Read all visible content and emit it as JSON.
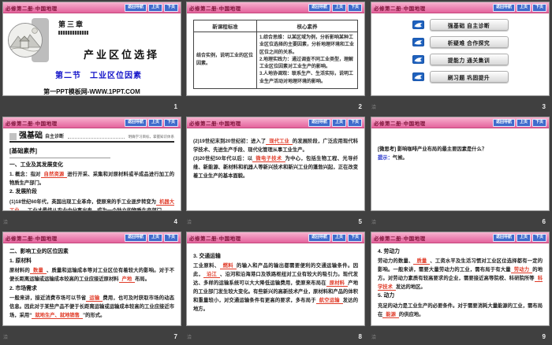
{
  "chrome": {
    "header_title": "必修第二册·中国地理",
    "nav_back": "返回导航",
    "nav_prev": "上页",
    "nav_next": "下页",
    "watermark": "洽",
    "accent_pink": "#ef8db8",
    "button_blue": "#3f6bcc",
    "blank_red": "#e03b28"
  },
  "s1": {
    "page": "1",
    "chapter": "第三章",
    "title": "产业区位选择",
    "subtitle": "第二节　工业区位因素",
    "footer": "第一PPT模板网-WWW.1PPT.COM"
  },
  "s2": {
    "page": "2",
    "col1": "新课程标准",
    "col2": "核心素养",
    "cell1": "结合实例，说明工业的区位因素。",
    "items": [
      "1.综合思维：以某区域为例，分析影响某种工业区位选择的主要因素，分析地理环境和工业区位之间的关系。",
      "2.地理实践力：通过调查不同工业类型，理解工业区位因素对工业生产的影响。",
      "3.人地协调观：联系生产、生活实际，说明工业生产活动对地理环境的影响。"
    ]
  },
  "s3": {
    "page": "3",
    "menu": [
      {
        "label": "强基础 自主诊断"
      },
      {
        "label": "析疑难 合作探究"
      },
      {
        "label": "提能力 通关集训"
      },
      {
        "label": "刷习题 巩固提升"
      }
    ]
  },
  "s4": {
    "page": "4",
    "section_big": "强基础",
    "section_small": "自主诊断",
    "section_note": "明确学习目标，掌握知识体系",
    "tag": "[基础素养]",
    "h1": "一、工业及其发展变化",
    "p1": [
      {
        "t": "1. 概念：指对"
      },
      {
        "b": "自然资源"
      },
      {
        "t": "进行开采、采集和对原材料或半成品进行加工的物质生产部门。"
      }
    ],
    "h2": "2. 发展阶段",
    "p2": [
      {
        "t": "(1)18世纪60年代，英国出现工业革命，使原来的手工业逐步转变为"
      },
      {
        "b": "机器大工业"
      },
      {
        "t": "，工业才最终从农业中分离出来，成为一个独立的物质生产部门。"
      }
    ]
  },
  "s5": {
    "page": "5",
    "p1": [
      {
        "t": "(2)19世纪末到20世纪初：进入了"
      },
      {
        "b": "现代工业"
      },
      {
        "t": "的发展阶段，广泛应用现代科学技术、先进生产手段、现代化管理从事工业生产。"
      }
    ],
    "p2": [
      {
        "t": "(3)20世纪50年代以后：以"
      },
      {
        "b": "微电子技术"
      },
      {
        "t": "为中心，包括生物工程、光导纤维、新能源、新材料和机器人等新兴技术和新兴工业的蓬勃兴起，正在改变着工业生产的基本面貌。"
      }
    ]
  },
  "s6": {
    "page": "6",
    "q": [
      {
        "k": "[微思考]"
      },
      {
        "t": " 影响咖啡产业布局的最主要因素是什么？"
      }
    ],
    "a": [
      {
        "c": "提示："
      },
      {
        "t": "气候。"
      }
    ]
  },
  "s7": {
    "page": "7",
    "h1": "二、影响工业的区位因素",
    "h2": "1. 原材料",
    "p1": [
      {
        "t": "原材料的"
      },
      {
        "b": "数量"
      },
      {
        "t": "、质量和运输成本等对工业区位有着较大的影响。对于不便长距离运输或运输成本较高的工业应接近原材料"
      },
      {
        "b": "产地"
      },
      {
        "t": "布局。"
      }
    ],
    "h3": "2. 市场需求",
    "p2": [
      {
        "t": "一般来讲，接近消费市场可以节省"
      },
      {
        "b": "运输"
      },
      {
        "t": "费用，也可及时获取市场的动态信息。因此对于某些产品不便于长距离运输或运输成本较高的工业应接近市场，采用“"
      },
      {
        "b": "就地生产、就地销售"
      },
      {
        "t": "”的形式。"
      }
    ]
  },
  "s8": {
    "page": "8",
    "h1": "3. 交通运输",
    "p1": [
      {
        "t": "工业原料、"
      },
      {
        "b": "燃料"
      },
      {
        "t": "的输入和产品的输出都需要便利的交通运输条件。因此，"
      },
      {
        "b": "沿江"
      },
      {
        "t": "、沿河和沿海港口及铁路枢纽对工业有较大的吸引力。现代发达、多样的运输系统可以大大降低运输费用，使原来布局在"
      },
      {
        "b": "原材料"
      },
      {
        "t": "产地的工业部门发生较大变化。有些新兴的高新技术产业，原材料和产品的体积和重量较小，对交通运输条件有更高的要求，多布局于"
      },
      {
        "b": "航空运输"
      },
      {
        "t": "发达的地方。"
      }
    ]
  },
  "s9": {
    "page": "9",
    "h1": "4. 劳动力",
    "p1": [
      {
        "t": "劳动力的数量、"
      },
      {
        "b": "质量"
      },
      {
        "t": "、工资水平及生活习惯对工业区位选择都有一定的影响。一般来讲，需要大量劳动力的工业，需布局于有大量"
      },
      {
        "b": "劳动力"
      },
      {
        "t": "的地方。对劳动力素质有较高要求的企业，需要接近高等院校、科研院所等"
      },
      {
        "b": "科学技术"
      },
      {
        "t": "发达的地区。"
      }
    ],
    "h2": "5. 动力",
    "p2": [
      {
        "t": "充足的动力是工业生产的必要条件。对于需要消耗大量能源的工业，需布局在"
      },
      {
        "b": "能源"
      },
      {
        "t": "的供应地。"
      }
    ]
  }
}
